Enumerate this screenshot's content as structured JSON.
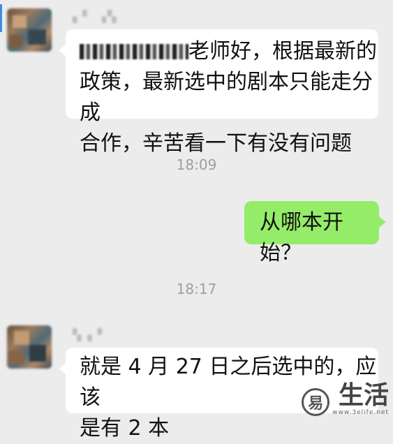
{
  "messages": [
    {
      "kind": "incoming",
      "sender_name": "▖▘ ▗▚",
      "text_line1_suffix": "老师好，根据最新的",
      "text_line2": "政策，最新选中的剧本只能走分成",
      "text_line3": "合作，辛苦看一下有没有问题"
    },
    {
      "kind": "timestamp",
      "time": "18:09"
    },
    {
      "kind": "outgoing",
      "text": "从哪本开始？"
    },
    {
      "kind": "timestamp",
      "time": "18:17"
    },
    {
      "kind": "incoming",
      "sender_name": "▚ ▖▘",
      "text_line1": "就是 4 月 27 日之后选中的，应该",
      "text_line2": "是有 2 本"
    }
  ],
  "watermark": {
    "title": "生活",
    "url": "www.3elife.net",
    "logo_glyph": "易"
  },
  "colors": {
    "background": "#ececec",
    "incoming_bubble": "#ffffff",
    "outgoing_bubble": "#95ec69"
  }
}
